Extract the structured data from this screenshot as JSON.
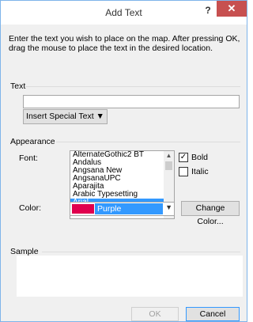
{
  "window": {
    "title": "Add Text",
    "help_label": "?",
    "close_label": "✕"
  },
  "intro_text": "Enter the text you wish to place on the map. After pressing OK, drag the mouse to place the text in the desired location.",
  "text_group": {
    "label": "Text",
    "input_value": "",
    "insert_button_label": "Insert Special Text ▼"
  },
  "appearance": {
    "label": "Appearance",
    "font_label": "Font:",
    "fonts": [
      "AlternateGothic2 BT",
      "Andalus",
      "Angsana New",
      "AngsanaUPC",
      "Aparajita",
      "Arabic Typesetting",
      "Arial"
    ],
    "selected_font": "Arial",
    "bold_label": "Bold",
    "bold_checked": true,
    "italic_label": "Italic",
    "italic_checked": false,
    "color_label": "Color:",
    "color_value": "Purple",
    "color_swatch": "#e0004e",
    "change_color_label": "Change Color..."
  },
  "sample_group": {
    "label": "Sample"
  },
  "buttons": {
    "ok_label": "OK",
    "cancel_label": "Cancel"
  },
  "colors": {
    "accent": "#3399ff",
    "close_button": "#c75050"
  }
}
